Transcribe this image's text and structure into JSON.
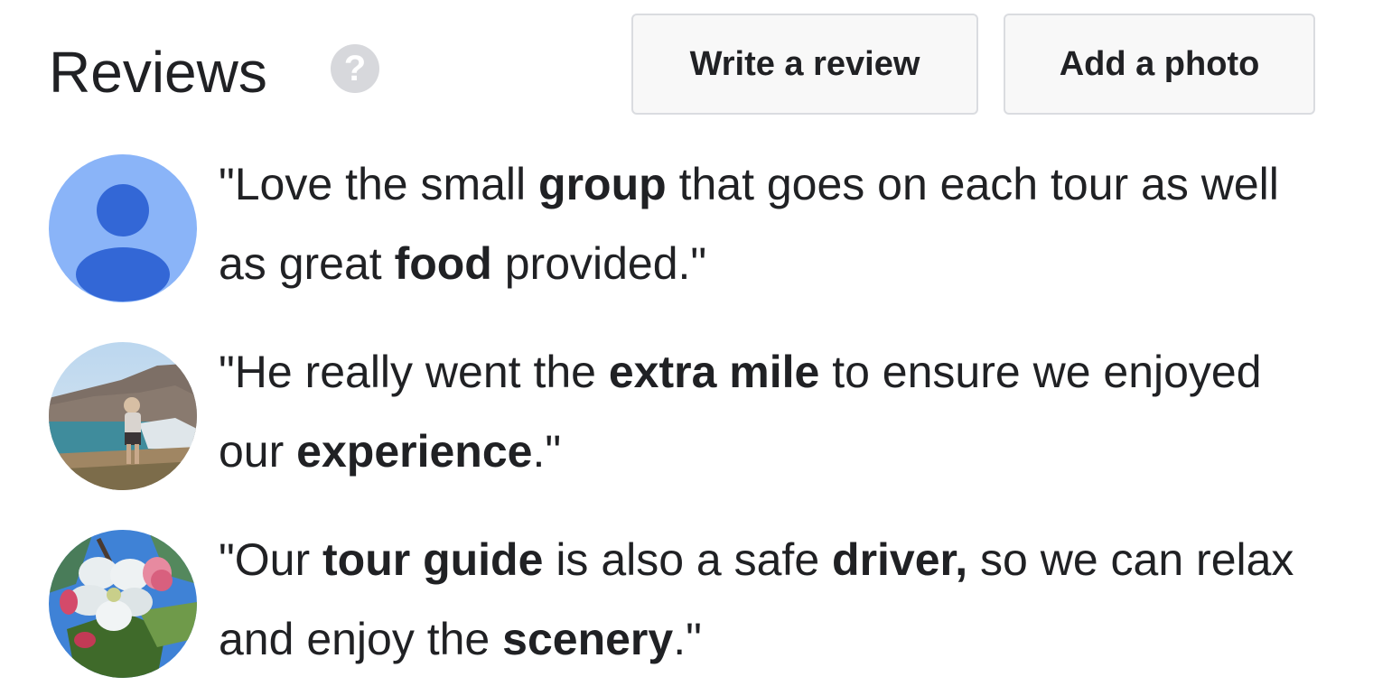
{
  "header": {
    "title": "Reviews",
    "help_icon": "?",
    "write_review_label": "Write a review",
    "add_photo_label": "Add a photo"
  },
  "colors": {
    "text": "#202124",
    "button_bg": "#f8f8f8",
    "button_border": "#dadce0",
    "help_icon_bg": "#d7d8dc",
    "default_avatar_bg": "#8ab4f8",
    "default_avatar_fg": "#3367d6"
  },
  "reviews": [
    {
      "avatar": "default-user-avatar",
      "segments": [
        {
          "text": "\"Love the small ",
          "bold": false
        },
        {
          "text": "group",
          "bold": true
        },
        {
          "text": " that goes on each tour as well as great ",
          "bold": false
        },
        {
          "text": "food",
          "bold": true
        },
        {
          "text": " provided.\"",
          "bold": false
        }
      ]
    },
    {
      "avatar": "coastal-cliff-photo-avatar",
      "segments": [
        {
          "text": "\"He really went the ",
          "bold": false
        },
        {
          "text": "extra mile",
          "bold": true
        },
        {
          "text": " to ensure we enjoyed our ",
          "bold": false
        },
        {
          "text": "experience",
          "bold": true
        },
        {
          "text": ".\"",
          "bold": false
        }
      ]
    },
    {
      "avatar": "apple-blossom-photo-avatar",
      "segments": [
        {
          "text": "\"Our ",
          "bold": false
        },
        {
          "text": "tour guide",
          "bold": true
        },
        {
          "text": " is also a safe ",
          "bold": false
        },
        {
          "text": "driver,",
          "bold": true
        },
        {
          "text": " so we can relax and enjoy the ",
          "bold": false
        },
        {
          "text": "scenery",
          "bold": true
        },
        {
          "text": ".\"",
          "bold": false
        }
      ]
    }
  ]
}
